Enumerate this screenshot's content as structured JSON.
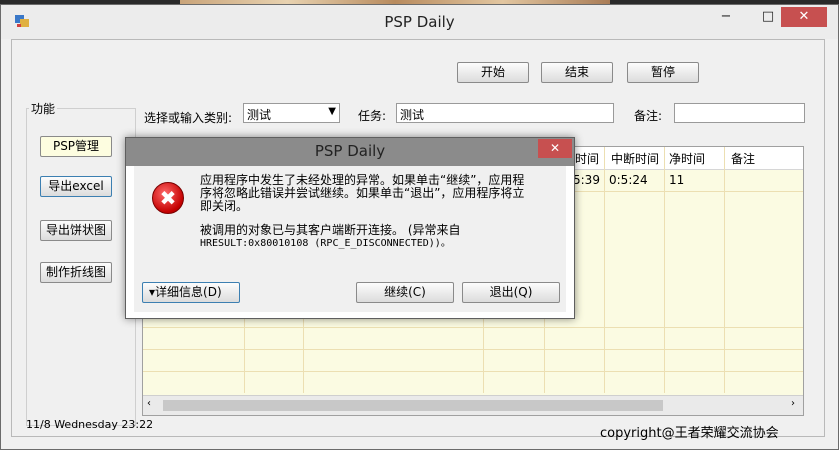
{
  "window": {
    "title": "PSP Daily",
    "min": "−",
    "max": "□",
    "close": "✕"
  },
  "toolbar": {
    "start": "开始",
    "end": "结束",
    "pause": "暂停"
  },
  "group": {
    "title": "功能",
    "buttons": [
      "PSP管理",
      "导出excel",
      "导出饼状图",
      "制作折线图"
    ]
  },
  "form": {
    "category_label": "选择或输入类别:",
    "category_value": "测试",
    "task_label": "任务:",
    "task_value": "测试",
    "note_label": "备注:",
    "note_value": ""
  },
  "grid": {
    "columns": [
      "时间",
      "中断时间",
      "净时间",
      "备注"
    ],
    "rows": [
      [
        "5:39",
        "0:5:24",
        "11",
        ""
      ]
    ]
  },
  "status": {
    "datetime": "11/8  Wednesday 23:22",
    "copyright": "copyright@王者荣耀交流协会"
  },
  "dialog": {
    "title": "PSP Daily",
    "close": "✕",
    "line1": "应用程序中发生了未经处理的异常。如果单击“继续”，应用程",
    "line2": "序将忽略此错误并尝试继续。如果单击“退出”，应用程序将立",
    "line3": "即关闭。",
    "line4": "被调用的对象已与其客户端断开连接。 (异常来自",
    "line5": "HRESULT:0x80010108 (RPC_E_DISCONNECTED))。",
    "details_button": "▾详细信息(D)",
    "continue_button": "继续(C)",
    "quit_button": "退出(Q)",
    "icon_glyph": "✖"
  }
}
